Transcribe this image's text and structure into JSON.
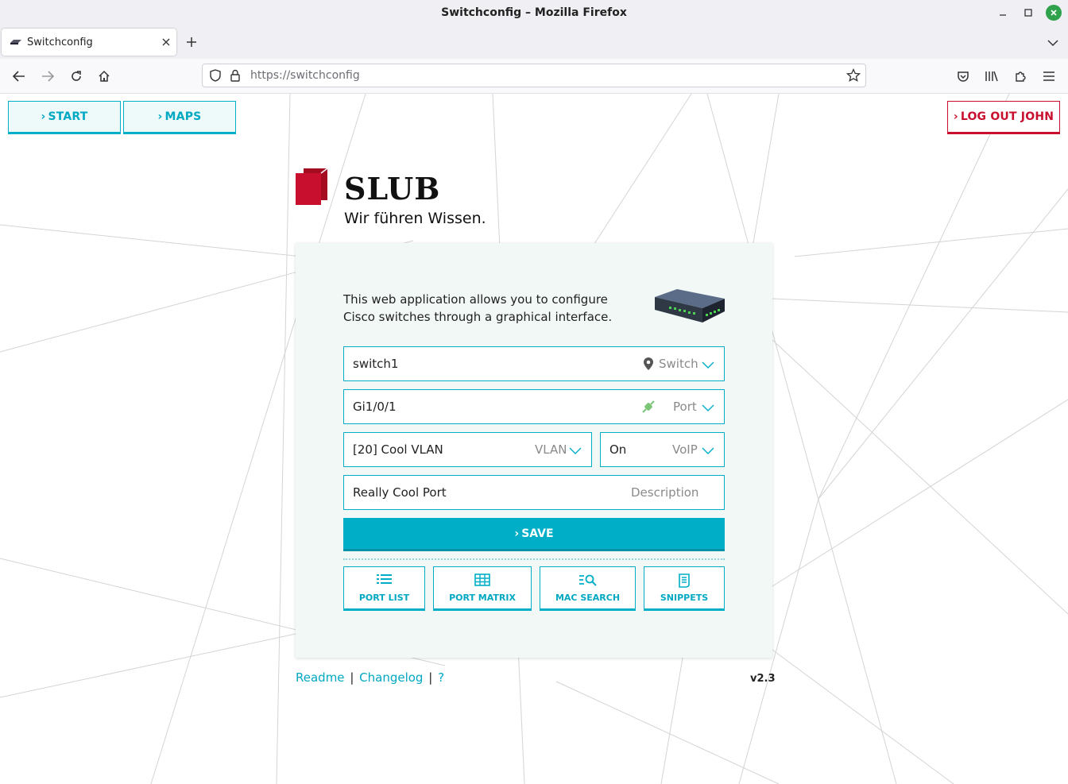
{
  "window": {
    "title": "Switchconfig – Mozilla Firefox"
  },
  "tabs": [
    {
      "label": "Switchconfig"
    }
  ],
  "urlbar": {
    "url": "https://switchconfig"
  },
  "header": {
    "start_label": "START",
    "maps_label": "MAPS",
    "logout_label": "LOG OUT JOHN"
  },
  "logo": {
    "brand": "SLUB",
    "tagline": "Wir führen Wissen.",
    "brand_color": "#c8102e"
  },
  "form": {
    "intro": "This web application allows you to configure Cisco switches through a graphical interface.",
    "switch": {
      "value": "switch1",
      "label": "Switch"
    },
    "port": {
      "value": "Gi1/0/1",
      "label": "Port"
    },
    "vlan": {
      "value": "[20] Cool VLAN",
      "label": "VLAN"
    },
    "voip": {
      "value": "On",
      "label": "VoIP"
    },
    "description": {
      "value": "Really Cool Port",
      "label": "Description"
    },
    "save_label": "SAVE"
  },
  "tools": [
    {
      "label": "PORT LIST",
      "icon": "list-icon"
    },
    {
      "label": "PORT MATRIX",
      "icon": "grid-icon"
    },
    {
      "label": "MAC SEARCH",
      "icon": "search-list-icon"
    },
    {
      "label": "SNIPPETS",
      "icon": "document-icon"
    }
  ],
  "footer": {
    "readme": "Readme",
    "changelog": "Changelog",
    "help": "?",
    "sep": "|",
    "version": "v2.3"
  },
  "colors": {
    "accent": "#00aec7",
    "logout": "#c8102e",
    "card_bg": "#f1f8f6"
  }
}
